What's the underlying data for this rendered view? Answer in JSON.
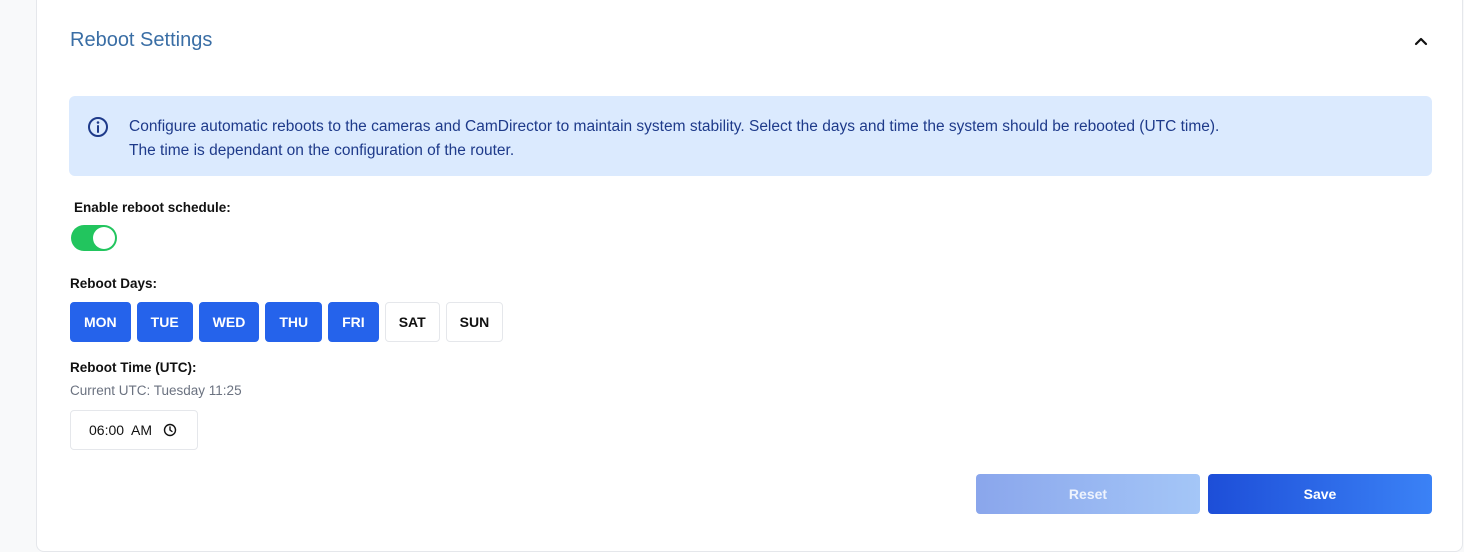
{
  "section": {
    "title": "Reboot Settings",
    "collapse_icon": "chevron-up-icon"
  },
  "info": {
    "icon": "info-icon",
    "line1": "Configure automatic reboots to the cameras and CamDirector to maintain system stability. Select the days and time the system should be rebooted (UTC time).",
    "line2": "The time is dependant on the configuration of the router."
  },
  "schedule": {
    "enable_label": "Enable reboot schedule:",
    "enabled": true,
    "toggle_color": "#22c55e"
  },
  "days": {
    "label": "Reboot Days:",
    "items": [
      {
        "label": "MON",
        "selected": true
      },
      {
        "label": "TUE",
        "selected": true
      },
      {
        "label": "WED",
        "selected": true
      },
      {
        "label": "THU",
        "selected": true
      },
      {
        "label": "FRI",
        "selected": true
      },
      {
        "label": "SAT",
        "selected": false
      },
      {
        "label": "SUN",
        "selected": false
      }
    ],
    "selected_color": "#2563eb"
  },
  "time": {
    "label": "Reboot Time (UTC):",
    "current_utc": "Current UTC: Tuesday 11:25",
    "value": "06:00  AM",
    "icon": "clock-icon"
  },
  "actions": {
    "reset_label": "Reset",
    "reset_enabled": false,
    "save_label": "Save"
  }
}
